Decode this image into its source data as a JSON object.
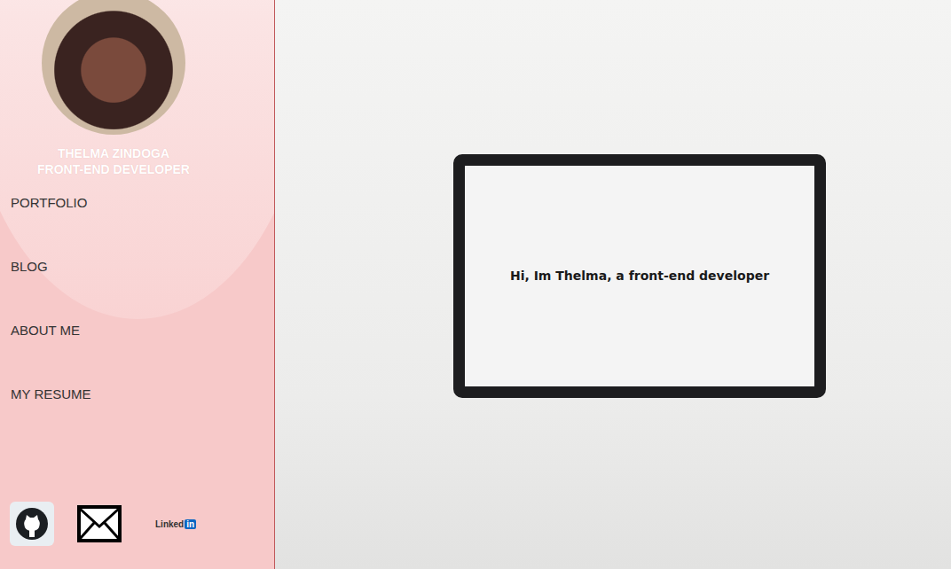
{
  "profile": {
    "name": "THELMA ZINDOGA",
    "title": "FRONT-END DEVELOPER"
  },
  "nav": {
    "items": [
      {
        "label": "PORTFOLIO"
      },
      {
        "label": "BLOG"
      },
      {
        "label": "ABOUT ME"
      },
      {
        "label": "MY RESUME"
      }
    ]
  },
  "socials": {
    "linkedin": {
      "word": "Linked",
      "badge": "in"
    }
  },
  "hero": {
    "text": "Hi, Im Thelma, a front-end developer"
  }
}
